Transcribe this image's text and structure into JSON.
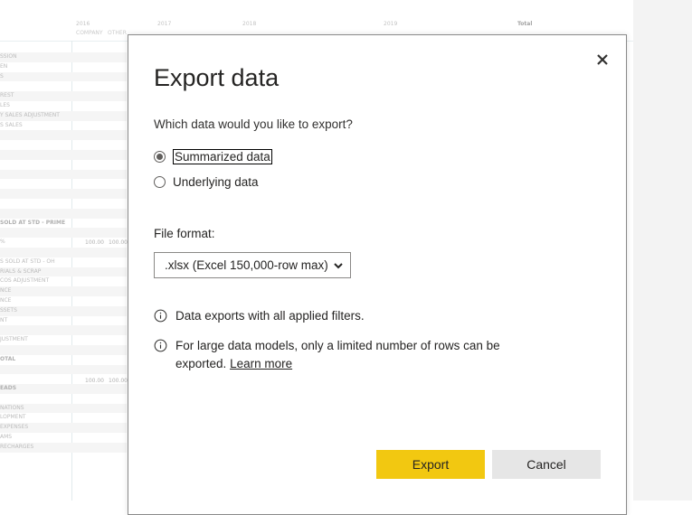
{
  "background": {
    "years": [
      "2016",
      "2017",
      "2018",
      "2019"
    ],
    "total_label": "Total",
    "columns": [
      "COMPANY",
      "OTHER"
    ],
    "rows": [
      {
        "text": "SSION",
        "shade": true,
        "bold": false
      },
      {
        "text": "EN",
        "shade": false,
        "bold": false
      },
      {
        "text": "S",
        "shade": true,
        "bold": false
      },
      {
        "text": "",
        "shade": false,
        "bold": false
      },
      {
        "text": "REST",
        "shade": true,
        "bold": false
      },
      {
        "text": "LES",
        "shade": false,
        "bold": false
      },
      {
        "text": "Y SALES ADJUSTMENT",
        "shade": true,
        "bold": false
      },
      {
        "text": "S SALES",
        "shade": false,
        "bold": false
      },
      {
        "text": "",
        "shade": true,
        "bold": false
      },
      {
        "text": "",
        "shade": false,
        "bold": false
      },
      {
        "text": "",
        "shade": true,
        "bold": false
      },
      {
        "text": "",
        "shade": false,
        "bold": false
      },
      {
        "text": "",
        "shade": true,
        "bold": false
      },
      {
        "text": "",
        "shade": false,
        "bold": false
      },
      {
        "text": "",
        "shade": true,
        "bold": false
      },
      {
        "text": "",
        "shade": false,
        "bold": false
      },
      {
        "text": "",
        "shade": true,
        "bold": false
      },
      {
        "text": "SOLD AT STD - PRIME",
        "shade": false,
        "bold": true
      },
      {
        "text": "",
        "shade": true,
        "bold": false
      },
      {
        "text": "%",
        "shade": false,
        "bold": false
      },
      {
        "text": "",
        "shade": true,
        "bold": false
      },
      {
        "text": "S SOLD AT STD - OH",
        "shade": false,
        "bold": false
      },
      {
        "text": "RIALS & SCRAP",
        "shade": true,
        "bold": false
      },
      {
        "text": "COS ADJUSTMENT",
        "shade": false,
        "bold": false
      },
      {
        "text": "NCE",
        "shade": true,
        "bold": false
      },
      {
        "text": "NCE",
        "shade": false,
        "bold": false
      },
      {
        "text": "SSETS",
        "shade": true,
        "bold": false
      },
      {
        "text": "NT",
        "shade": false,
        "bold": false
      },
      {
        "text": "",
        "shade": true,
        "bold": false
      },
      {
        "text": "JUSTMENT",
        "shade": false,
        "bold": false
      },
      {
        "text": "",
        "shade": true,
        "bold": false
      },
      {
        "text": "OTAL",
        "shade": false,
        "bold": true
      },
      {
        "text": "",
        "shade": true,
        "bold": false
      },
      {
        "text": "",
        "shade": false,
        "bold": false
      },
      {
        "text": "EADS",
        "shade": true,
        "bold": true
      },
      {
        "text": "",
        "shade": false,
        "bold": false
      },
      {
        "text": "NATIONS",
        "shade": true,
        "bold": false
      },
      {
        "text": "LOPMENT",
        "shade": false,
        "bold": false
      },
      {
        "text": "EXPENSES",
        "shade": true,
        "bold": false
      },
      {
        "text": "AMS",
        "shade": false,
        "bold": false
      },
      {
        "text": "RECHARGES",
        "shade": true,
        "bold": false
      }
    ],
    "values": [
      "100.00",
      "100.00",
      "100.00",
      "100.00"
    ]
  },
  "dialog": {
    "title": "Export data",
    "close_icon": "close-icon",
    "question": "Which data would you like to export?",
    "options": [
      {
        "label": "Summarized data",
        "selected": true
      },
      {
        "label": "Underlying data",
        "selected": false
      }
    ],
    "file_format_label": "File format:",
    "file_format_value": ".xlsx (Excel 150,000-row max)",
    "info_1": "Data exports with all applied filters.",
    "info_2": "For large data models, only a limited number of rows can be exported.",
    "learn_more": "Learn more",
    "export_button": "Export",
    "cancel_button": "Cancel",
    "colors": {
      "primary": "#f2c811",
      "secondary": "#e6e6e6",
      "text": "#252423"
    }
  }
}
